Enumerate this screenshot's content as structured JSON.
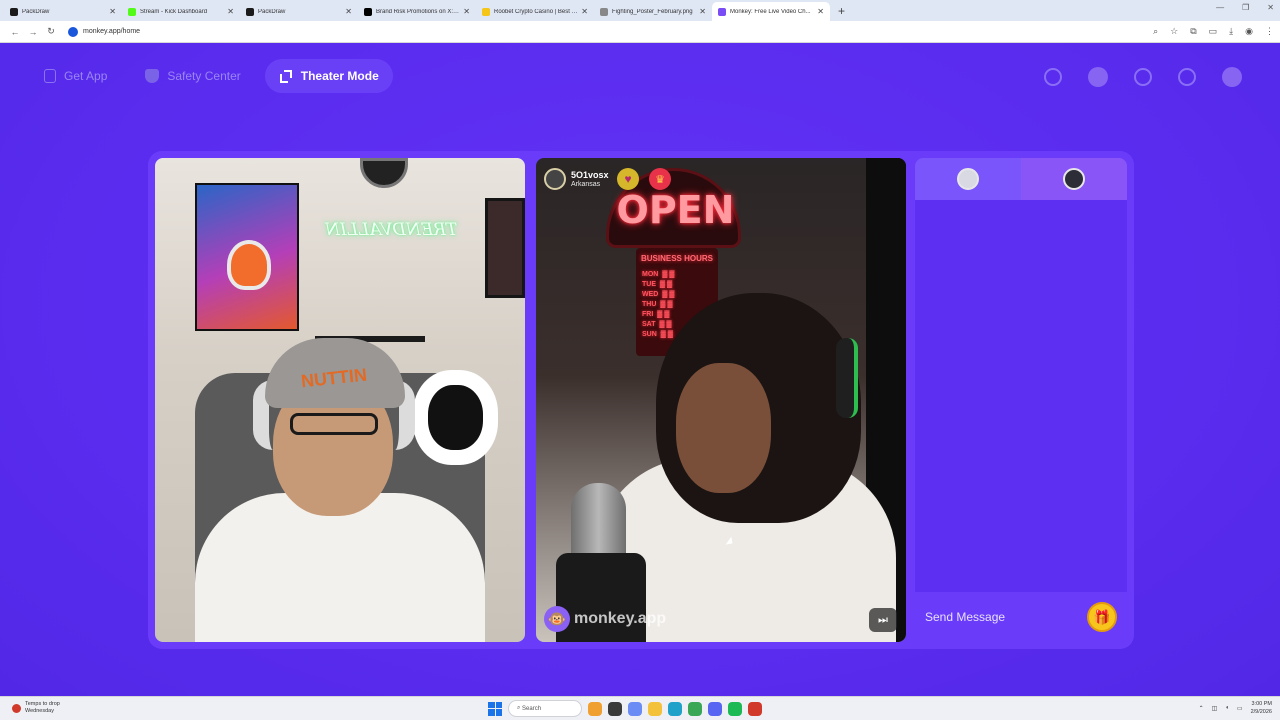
{
  "browser": {
    "tabs": [
      {
        "label": "PackDraw",
        "color": "#1b1b1b",
        "active": false
      },
      {
        "label": "Stream - Kick Dashboard",
        "color": "#53fc18",
        "active": false
      },
      {
        "label": "PackDraw",
        "color": "#1b1b1b",
        "active": false
      },
      {
        "label": "Brand Risk Promotions on X: '#...",
        "color": "#000000",
        "active": false
      },
      {
        "label": "Roobet Crypto Casino | Best Bit...",
        "color": "#f5c518",
        "active": false
      },
      {
        "label": "Fighting_Poster_February.png",
        "color": "#888888",
        "active": false
      },
      {
        "label": "Monkey: Free Live Video Ch...",
        "color": "#7a4cf5",
        "active": true
      }
    ],
    "url": "monkey.app/home"
  },
  "app": {
    "nav": {
      "get_app": "Get App",
      "safety_center": "Safety Center",
      "theater_mode": "Theater Mode"
    },
    "stranger": {
      "username": "5O1vosx",
      "location": "Arkansas"
    },
    "scene": {
      "neon_sign": "TRENDVALLIN",
      "beanie_text": "NUTTIN",
      "open_sign": "OPEN",
      "hours_title": "BUSINESS HOURS",
      "hours_rows": "MON  ▓ ▓\nTUE  ▓ ▓\nWED  ▓ ▓\nTHU  ▓ ▓\nFRI  ▓ ▓\nSAT  ▓ ▓\nSUN  ▓ ▓"
    },
    "watermark": "monkey.app",
    "chat": {
      "placeholder": "Send Message"
    },
    "colors": {
      "background": "#5b2cf0",
      "stage": "#6a3cfa",
      "accent": "#7a55fb",
      "gift": "#f7c51b"
    }
  },
  "taskbar": {
    "weather_line1": "Temps to drop",
    "weather_line2": "Wednesday",
    "search": "Search",
    "time": "3:00 PM",
    "date": "2/9/2026"
  }
}
